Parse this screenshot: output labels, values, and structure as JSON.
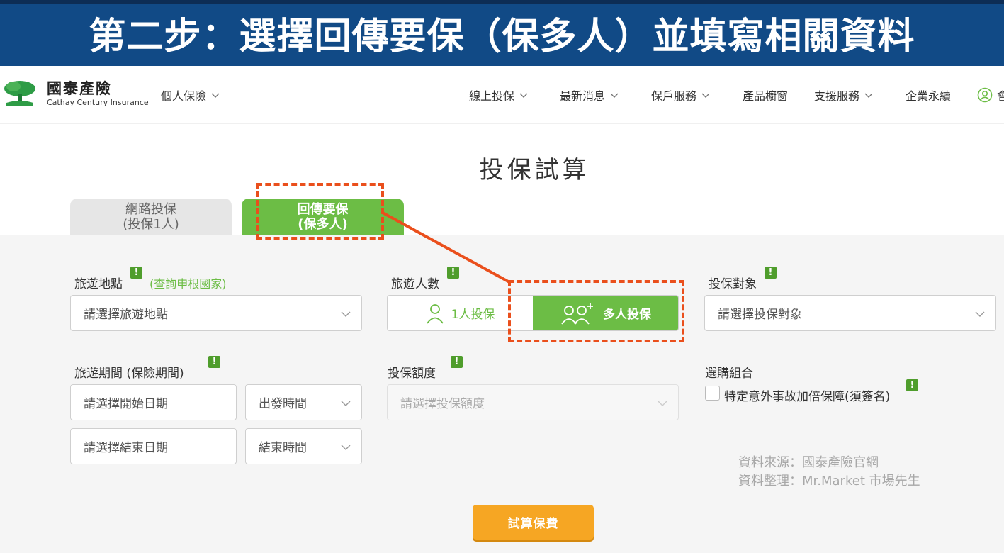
{
  "banner": {
    "title": "第二步：選擇回傳要保（保多人）並填寫相關資料"
  },
  "header": {
    "logo_cn": "國泰產險",
    "logo_en": "Cathay Century Insurance",
    "personal": "個人保險",
    "nav": [
      "線上投保",
      "最新消息",
      "保戶服務",
      "產品櫥窗",
      "支援服務",
      "企業永續"
    ],
    "member": "會"
  },
  "page_title": "投保試算",
  "tabs": {
    "online_line1": "網路投保",
    "online_line2": "(投保1人)",
    "multi_line1": "回傳要保",
    "multi_line2": "(保多人)"
  },
  "form": {
    "destination_label": "旅遊地點",
    "destination_link": "(查詢申根國家)",
    "destination_placeholder": "請選擇旅遊地點",
    "travelers_label": "旅遊人數",
    "one_person": "1人投保",
    "multi_person": "多人投保",
    "insured_label": "投保對象",
    "insured_placeholder": "請選擇投保對象",
    "period_label": "旅遊期間 (保險期間)",
    "start_date": "請選擇開始日期",
    "depart_time": "出發時間",
    "end_date": "請選擇結束日期",
    "end_time": "結束時間",
    "amount_label": "投保額度",
    "amount_placeholder": "請選擇投保額度",
    "combo_label": "選購組合",
    "combo_option": "特定意外事故加倍保障(須簽名)",
    "info_mark": "!"
  },
  "source": {
    "line1": "資料來源：國泰產險官網",
    "line2": "資料整理：Mr.Market 市場先生"
  },
  "calc_button": "試算保費",
  "colors": {
    "banner": "#114a86",
    "green": "#6cbd45",
    "orange": "#f6a623",
    "annotation": "#ea4f1c"
  }
}
